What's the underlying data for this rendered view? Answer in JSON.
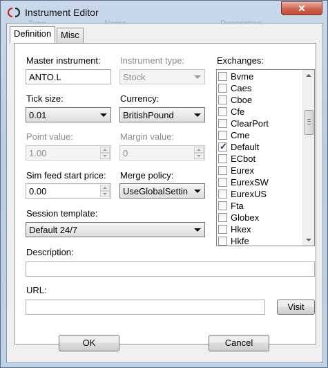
{
  "window": {
    "title": "Instrument Editor",
    "close_symbol": "✕",
    "behind_labels": [
      "Type",
      "Name",
      "Description"
    ]
  },
  "tabs": [
    {
      "label": "Definition",
      "selected": true
    },
    {
      "label": "Misc",
      "selected": false
    }
  ],
  "definition": {
    "master_instrument": {
      "label": "Master instrument:",
      "value": "ANTO.L"
    },
    "instrument_type": {
      "label": "Instrument type:",
      "value": "Stock",
      "enabled": false
    },
    "tick_size": {
      "label": "Tick size:",
      "value": "0.01"
    },
    "currency": {
      "label": "Currency:",
      "value": "BritishPound"
    },
    "point_value": {
      "label": "Point value:",
      "value": "1.00",
      "enabled": false
    },
    "margin_value": {
      "label": "Margin value:",
      "value": "0",
      "enabled": false
    },
    "sim_feed_start_price": {
      "label": "Sim feed start price:",
      "value": "0.00"
    },
    "merge_policy": {
      "label": "Merge policy:",
      "value": "UseGlobalSettin"
    },
    "session_template": {
      "label": "Session template:",
      "value": "Default 24/7"
    },
    "description": {
      "label": "Description:",
      "value": ""
    },
    "url": {
      "label": "URL:",
      "value": ""
    },
    "visit_label": "Visit",
    "exchanges": {
      "label": "Exchanges:",
      "items": [
        {
          "name": "Bvme",
          "checked": false
        },
        {
          "name": "Caes",
          "checked": false
        },
        {
          "name": "Cboe",
          "checked": false
        },
        {
          "name": "Cfe",
          "checked": false
        },
        {
          "name": "ClearPort",
          "checked": false
        },
        {
          "name": "Cme",
          "checked": false
        },
        {
          "name": "Default",
          "checked": true
        },
        {
          "name": "ECbot",
          "checked": false
        },
        {
          "name": "Eurex",
          "checked": false
        },
        {
          "name": "EurexSW",
          "checked": false
        },
        {
          "name": "EurexUS",
          "checked": false
        },
        {
          "name": "Fta",
          "checked": false
        },
        {
          "name": "Globex",
          "checked": false
        },
        {
          "name": "Hkex",
          "checked": false
        },
        {
          "name": "Hkfe",
          "checked": false
        }
      ]
    }
  },
  "footer": {
    "ok_label": "OK",
    "cancel_label": "Cancel"
  },
  "colors": {
    "accent": "#23346b",
    "title_bar": "#c9d9ea",
    "close_button": "#d0624f"
  }
}
